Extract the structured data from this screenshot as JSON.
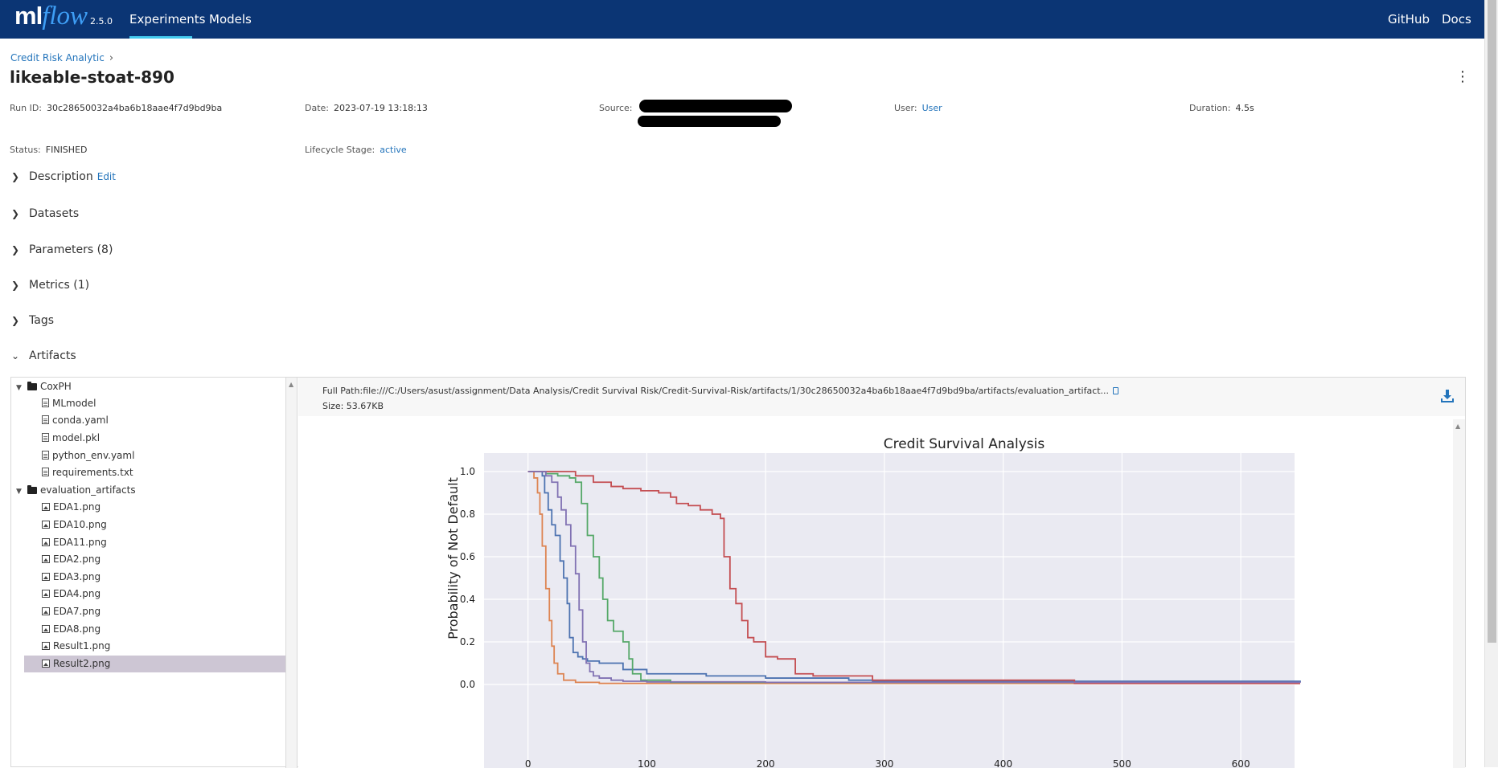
{
  "header": {
    "logo_ml": "ml",
    "logo_flow": "flow",
    "version": "2.5.0",
    "nav": [
      {
        "label": "Experiments"
      },
      {
        "label": "Models"
      }
    ],
    "right_links": [
      {
        "label": "GitHub"
      },
      {
        "label": "Docs"
      }
    ]
  },
  "breadcrumb": {
    "experiment": "Credit Risk Analytic",
    "separator": "›"
  },
  "run": {
    "title": "likeable-stoat-890",
    "run_id_label": "Run ID:",
    "run_id": "30c28650032a4ba6b18aae4f7d9bd9ba",
    "date_label": "Date:",
    "date": "2023-07-19 13:18:13",
    "source_label": "Source:",
    "user_label": "User:",
    "user": "User",
    "duration_label": "Duration:",
    "duration": "4.5s",
    "status_label": "Status:",
    "status": "FINISHED",
    "lifecycle_label": "Lifecycle Stage:",
    "lifecycle": "active"
  },
  "sections": [
    {
      "label": "Description",
      "edit": "Edit",
      "expanded": false
    },
    {
      "label": "Datasets",
      "expanded": false
    },
    {
      "label": "Parameters (8)",
      "expanded": false
    },
    {
      "label": "Metrics (1)",
      "expanded": false
    },
    {
      "label": "Tags",
      "expanded": false
    },
    {
      "label": "Artifacts",
      "expanded": true
    }
  ],
  "artifacts": {
    "tree": [
      {
        "label": "CoxPH",
        "type": "folder"
      },
      {
        "label": "MLmodel",
        "type": "file"
      },
      {
        "label": "conda.yaml",
        "type": "file"
      },
      {
        "label": "model.pkl",
        "type": "file"
      },
      {
        "label": "python_env.yaml",
        "type": "file"
      },
      {
        "label": "requirements.txt",
        "type": "file"
      },
      {
        "label": "evaluation_artifacts",
        "type": "folder"
      },
      {
        "label": "EDA1.png",
        "type": "image"
      },
      {
        "label": "EDA10.png",
        "type": "image"
      },
      {
        "label": "EDA11.png",
        "type": "image"
      },
      {
        "label": "EDA2.png",
        "type": "image"
      },
      {
        "label": "EDA3.png",
        "type": "image"
      },
      {
        "label": "EDA4.png",
        "type": "image"
      },
      {
        "label": "EDA7.png",
        "type": "image"
      },
      {
        "label": "EDA8.png",
        "type": "image"
      },
      {
        "label": "Result1.png",
        "type": "image"
      },
      {
        "label": "Result2.png",
        "type": "image",
        "selected": true
      }
    ],
    "full_path_label": "Full Path:",
    "full_path": "file:///C:/Users/asust/assignment/Data Analysis/Credit Survival Risk/Credit-Survival-Risk/artifacts/1/30c28650032a4ba6b18aae4f7d9bd9ba/artifacts/evaluation_artifact...",
    "size_label": "Size:",
    "size": "53.67KB"
  },
  "colors": {
    "header_bg": "#0b3574",
    "accent_underline": "#43c9ed",
    "link": "#2374bb",
    "selected_row": "#cdc6d4",
    "plot_bg": "#eaeaf2"
  },
  "chart_data": {
    "type": "line",
    "title": "Credit Survival Analysis",
    "xlabel": "",
    "ylabel": "Probability of Not Default",
    "xlim": [
      -37,
      650
    ],
    "ylim": [
      -0.04,
      1.04
    ],
    "x_ticks": [
      0,
      100,
      200,
      300,
      400,
      500,
      600
    ],
    "y_ticks": [
      "0.0",
      "0.2",
      "0.4",
      "0.6",
      "0.8",
      "1.0"
    ],
    "grid": true,
    "step": true,
    "series": [
      {
        "color": "#4c72b0",
        "x": [
          0,
          12,
          14,
          17,
          20,
          23,
          27,
          30,
          33,
          35,
          38,
          42,
          46,
          50,
          60,
          80,
          100,
          150,
          200,
          270,
          290,
          550,
          650
        ],
        "y": [
          1.0,
          0.98,
          0.9,
          0.82,
          0.75,
          0.7,
          0.58,
          0.5,
          0.38,
          0.22,
          0.15,
          0.13,
          0.12,
          0.11,
          0.1,
          0.07,
          0.05,
          0.04,
          0.03,
          0.02,
          0.015,
          0.015,
          0.012
        ]
      },
      {
        "color": "#dd8452",
        "x": [
          0,
          5,
          8,
          10,
          12,
          15,
          18,
          20,
          22,
          25,
          30,
          40,
          60,
          100,
          200,
          650
        ],
        "y": [
          1.0,
          0.97,
          0.9,
          0.8,
          0.65,
          0.45,
          0.3,
          0.18,
          0.1,
          0.05,
          0.02,
          0.01,
          0.005,
          0.005,
          0.005,
          0.005
        ]
      },
      {
        "color": "#55a868",
        "x": [
          0,
          15,
          25,
          35,
          40,
          45,
          50,
          55,
          60,
          63,
          67,
          72,
          80,
          85,
          88,
          95,
          120,
          200,
          650
        ],
        "y": [
          1.0,
          0.99,
          0.98,
          0.97,
          0.95,
          0.85,
          0.7,
          0.6,
          0.5,
          0.4,
          0.3,
          0.25,
          0.2,
          0.12,
          0.05,
          0.02,
          0.01,
          0.01,
          0.01
        ]
      },
      {
        "color": "#c44e52",
        "x": [
          0,
          25,
          40,
          55,
          70,
          80,
          95,
          110,
          120,
          125,
          135,
          145,
          155,
          162,
          165,
          170,
          175,
          180,
          185,
          190,
          200,
          210,
          225,
          240,
          290,
          460,
          650
        ],
        "y": [
          1.0,
          1.0,
          0.98,
          0.95,
          0.93,
          0.92,
          0.91,
          0.9,
          0.88,
          0.85,
          0.84,
          0.82,
          0.8,
          0.78,
          0.6,
          0.45,
          0.38,
          0.3,
          0.22,
          0.2,
          0.13,
          0.12,
          0.05,
          0.04,
          0.02,
          0.005,
          0.005
        ]
      },
      {
        "color": "#8172b3",
        "x": [
          0,
          15,
          20,
          25,
          28,
          32,
          36,
          40,
          43,
          46,
          49,
          52,
          55,
          60,
          70,
          80,
          100,
          200,
          650
        ],
        "y": [
          1.0,
          0.98,
          0.95,
          0.88,
          0.82,
          0.75,
          0.65,
          0.52,
          0.35,
          0.2,
          0.1,
          0.06,
          0.04,
          0.03,
          0.02,
          0.015,
          0.012,
          0.01,
          0.008
        ]
      }
    ]
  }
}
